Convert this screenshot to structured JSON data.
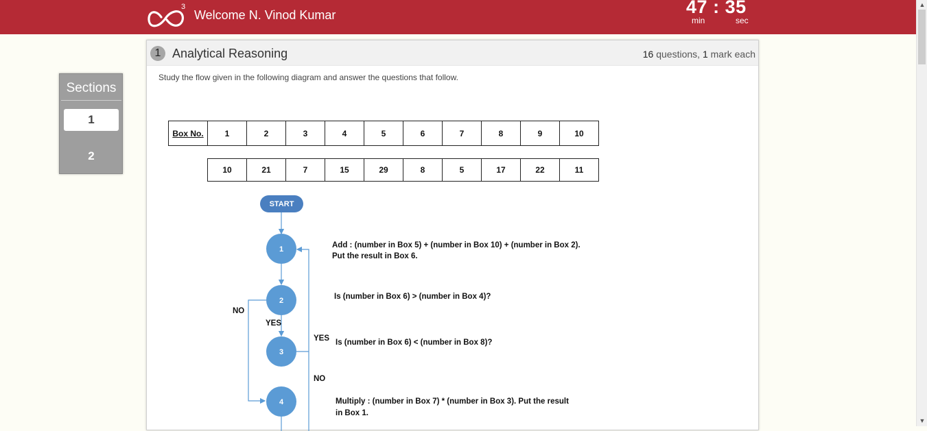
{
  "header": {
    "welcome_text": "Welcome N. Vinod Kumar",
    "logo_superscript": "3",
    "timer": {
      "minutes": "47",
      "separator": ":",
      "seconds": "35",
      "min_label": "min",
      "sec_label": "sec"
    }
  },
  "sections": {
    "title": "Sections",
    "items": [
      {
        "label": "1",
        "active": true
      },
      {
        "label": "2",
        "active": false
      }
    ]
  },
  "question": {
    "number": "1",
    "title": "Analytical Reasoning",
    "count": "16",
    "count_suffix": " questions, ",
    "marks": "1",
    "marks_suffix": " mark each",
    "instruction": "Study the flow given in the following diagram and answer the questions that follow."
  },
  "box_table": {
    "header_label": "Box No.",
    "box_numbers": [
      "1",
      "2",
      "3",
      "4",
      "5",
      "6",
      "7",
      "8",
      "9",
      "10"
    ],
    "box_values": [
      "10",
      "21",
      "7",
      "15",
      "29",
      "8",
      "5",
      "17",
      "22",
      "11"
    ]
  },
  "flowchart": {
    "start_label": "START",
    "steps": [
      {
        "id": "1",
        "text_lines": [
          "Add : (number in Box 5) + (number in Box 10) + (number in Box 2).",
          "Put the result in Box 6."
        ]
      },
      {
        "id": "2",
        "text_lines": [
          "Is (number in Box 6) > (number in Box 4)?"
        ]
      },
      {
        "id": "3",
        "text_lines": [
          "Is (number in Box 6) < (number in Box 8)?"
        ]
      },
      {
        "id": "4",
        "text_lines": [
          "Multiply : (number in Box 7) * (number in Box 3). Put the result",
          "in Box 1."
        ]
      }
    ],
    "branch_labels": {
      "no_left": "NO",
      "yes_mid": "YES",
      "yes_right": "YES",
      "no_right": "NO"
    }
  },
  "colors": {
    "header": "#b52a35",
    "node": "#5b9bd5",
    "start": "#4a7fc0"
  }
}
